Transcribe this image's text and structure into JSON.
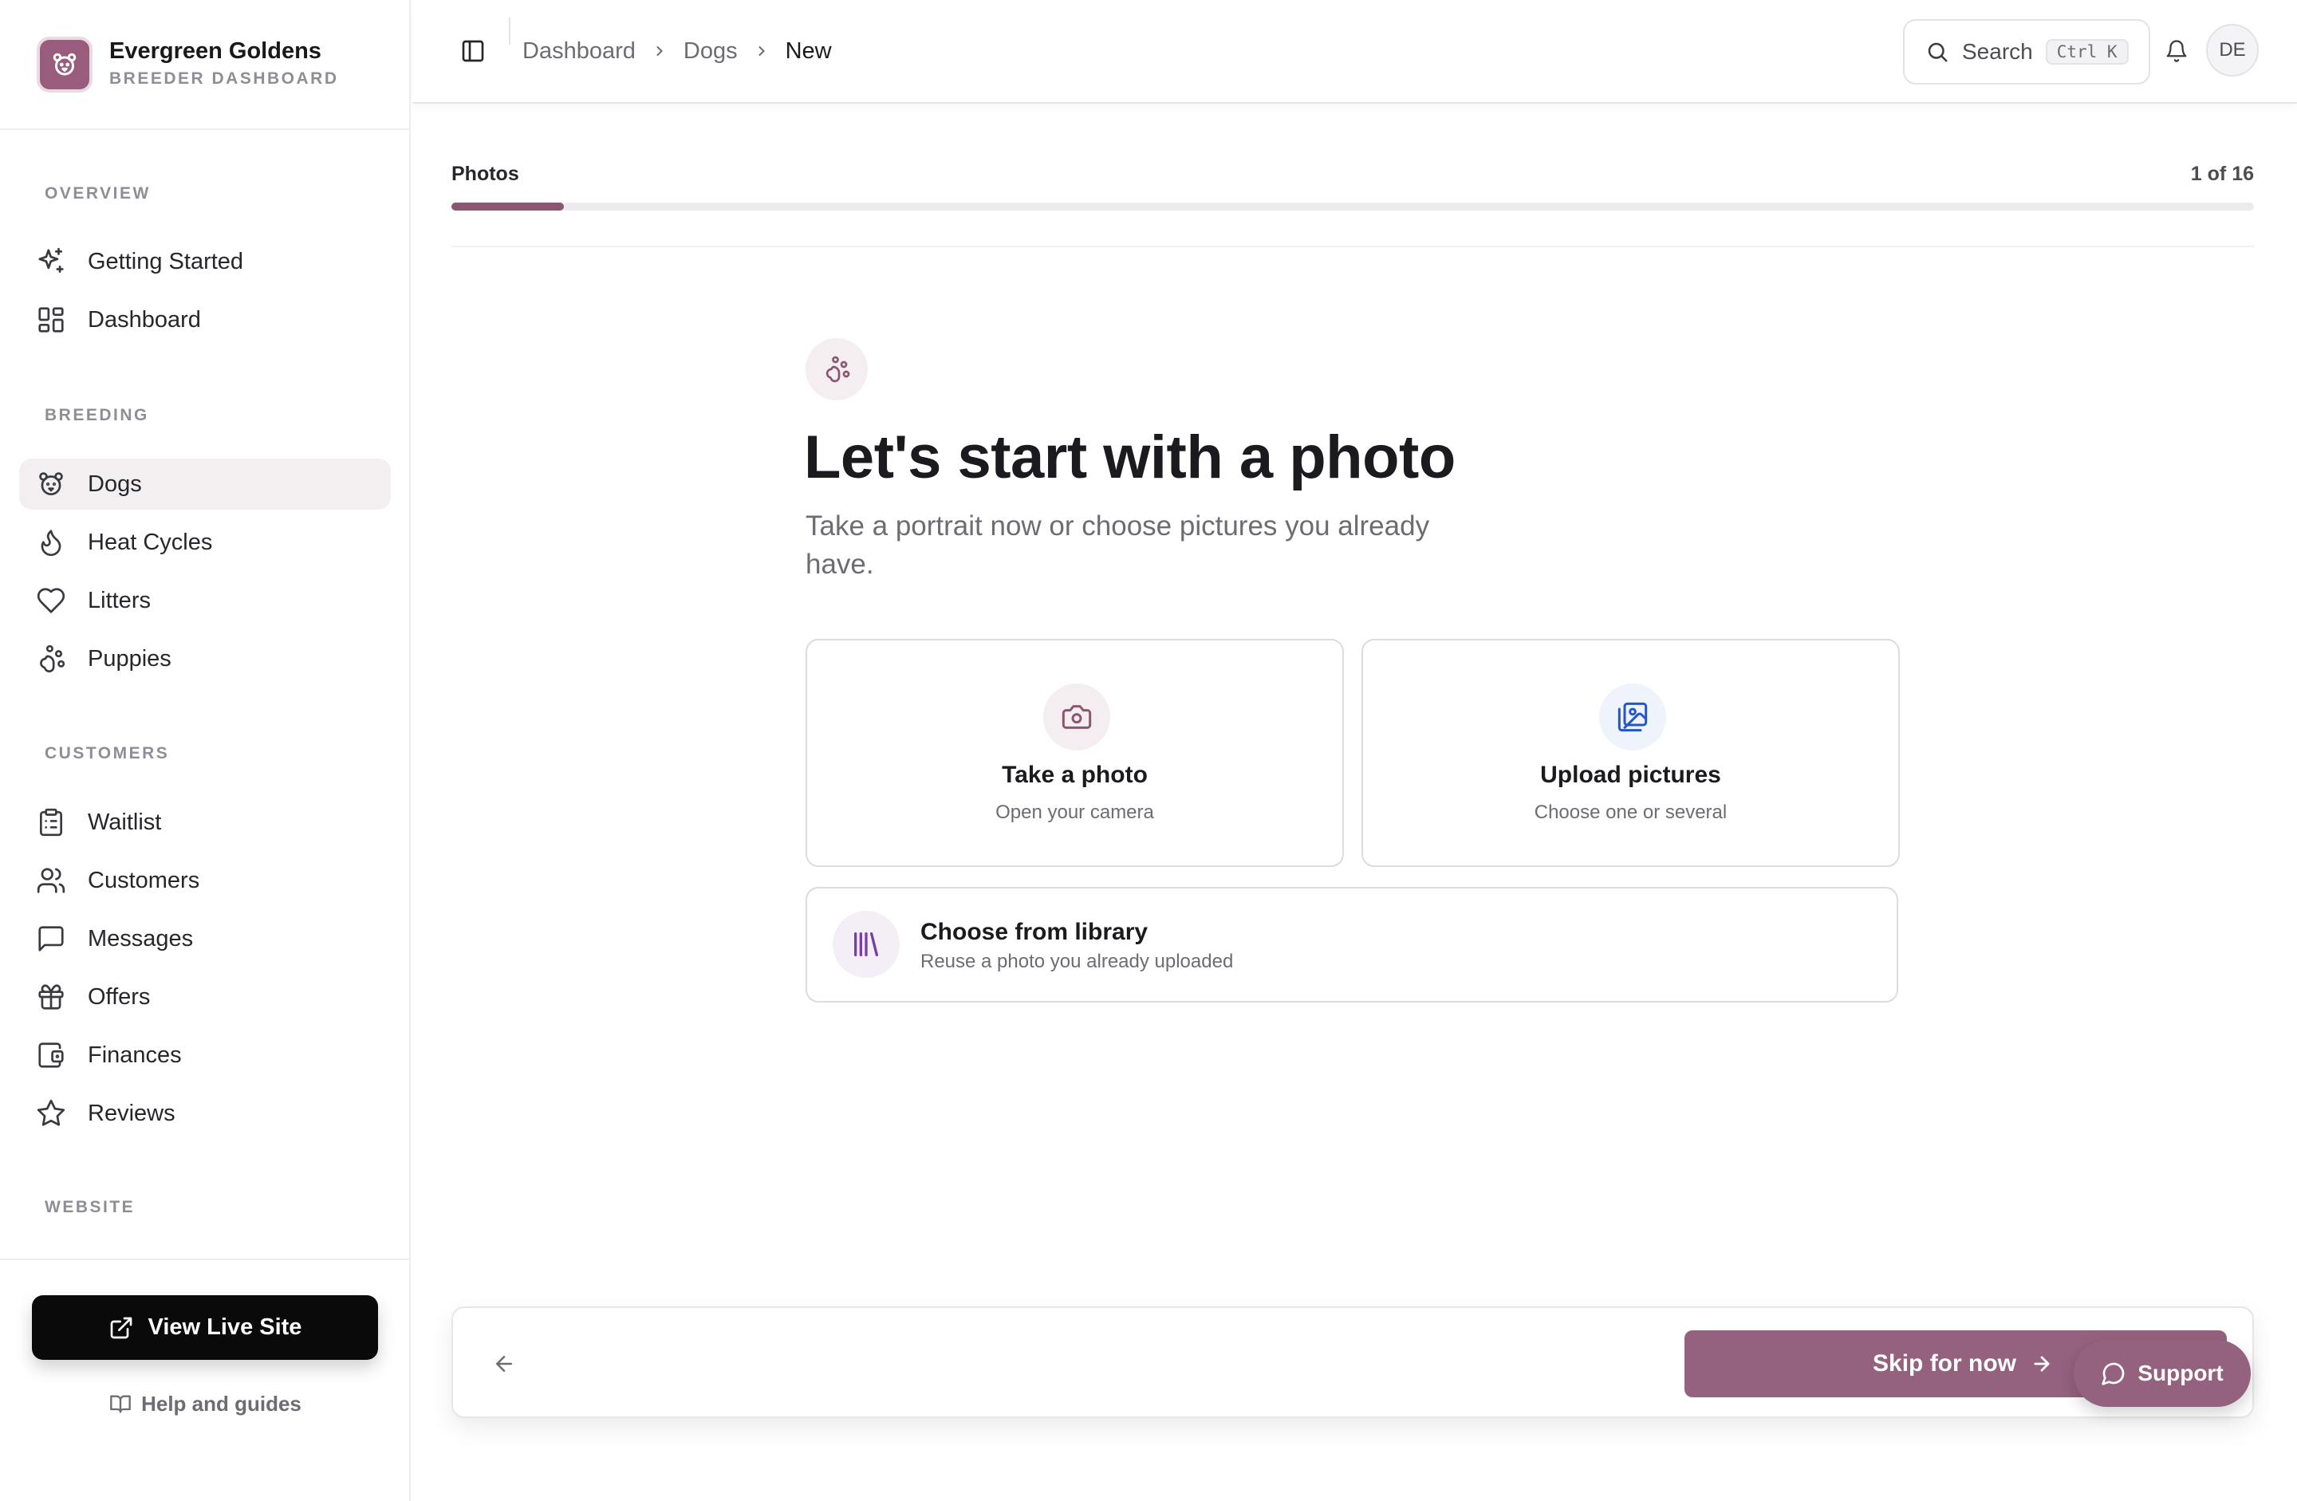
{
  "brand": {
    "name": "Evergreen Goldens",
    "subtitle": "BREEDER DASHBOARD",
    "logo_icon": "bear-face-icon",
    "accent": "#9a5c7c"
  },
  "sidebar": {
    "sections": [
      {
        "title": "OVERVIEW",
        "items": [
          {
            "label": "Getting Started",
            "icon": "sparkles-icon"
          },
          {
            "label": "Dashboard",
            "icon": "layout-grid-icon"
          }
        ]
      },
      {
        "title": "BREEDING",
        "items": [
          {
            "label": "Dogs",
            "icon": "dog-face-icon",
            "active": true
          },
          {
            "label": "Heat Cycles",
            "icon": "flame-icon"
          },
          {
            "label": "Litters",
            "icon": "heart-icon"
          },
          {
            "label": "Puppies",
            "icon": "paw-icon"
          }
        ]
      },
      {
        "title": "CUSTOMERS",
        "items": [
          {
            "label": "Waitlist",
            "icon": "clipboard-list-icon"
          },
          {
            "label": "Customers",
            "icon": "users-icon"
          },
          {
            "label": "Messages",
            "icon": "message-square-icon"
          },
          {
            "label": "Offers",
            "icon": "gift-icon"
          },
          {
            "label": "Finances",
            "icon": "wallet-icon"
          },
          {
            "label": "Reviews",
            "icon": "star-icon"
          }
        ]
      },
      {
        "title": "WEBSITE",
        "items": []
      }
    ],
    "view_live_site": "View Live Site",
    "help": "Help and guides"
  },
  "topbar": {
    "breadcrumb": [
      "Dashboard",
      "Dogs",
      "New"
    ],
    "search_label": "Search",
    "search_shortcut": "Ctrl K",
    "avatar_initials": "DE"
  },
  "wizard": {
    "step_label": "Photos",
    "step_count": "1 of 16",
    "progress_fraction": 0.0625,
    "accent": "#8c5672",
    "title": "Let's start with a photo",
    "subtitle": "Take a portrait now or choose pictures you already have.",
    "options": [
      {
        "title": "Take a photo",
        "desc": "Open your camera",
        "icon": "camera-icon"
      },
      {
        "title": "Upload pictures",
        "desc": "Choose one or several",
        "icon": "images-icon"
      }
    ],
    "library": {
      "title": "Choose from library",
      "desc": "Reuse a photo you already uploaded",
      "icon": "library-icon"
    },
    "skip_label": "Skip for now"
  },
  "support_label": "Support"
}
